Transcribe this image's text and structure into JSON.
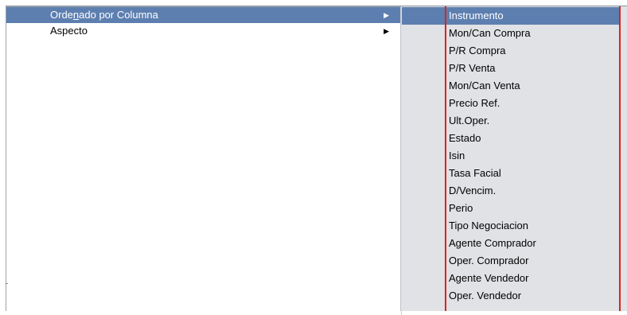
{
  "main_menu": {
    "items": [
      {
        "label": "Ordenado por Columna",
        "selected": true,
        "has_submenu": true
      },
      {
        "label": "Aspecto",
        "selected": false,
        "has_submenu": true
      }
    ],
    "submenu_arrow": "▶"
  },
  "submenu": {
    "items": [
      {
        "label": "Instrumento",
        "selected": true
      },
      {
        "label": "Mon/Can Compra",
        "selected": false
      },
      {
        "label": "P/R Compra",
        "selected": false
      },
      {
        "label": "P/R Venta",
        "selected": false
      },
      {
        "label": "Mon/Can Venta",
        "selected": false
      },
      {
        "label": "Precio Ref.",
        "selected": false
      },
      {
        "label": "Ult.Oper.",
        "selected": false
      },
      {
        "label": "Estado",
        "selected": false
      },
      {
        "label": "Isin",
        "selected": false
      },
      {
        "label": "Tasa Facial",
        "selected": false
      },
      {
        "label": "D/Vencim.",
        "selected": false
      },
      {
        "label": "Perio",
        "selected": false
      },
      {
        "label": "Tipo Negociacion",
        "selected": false
      },
      {
        "label": "Agente Comprador",
        "selected": false
      },
      {
        "label": "Oper. Comprador",
        "selected": false
      },
      {
        "label": "Agente Vendedor",
        "selected": false
      },
      {
        "label": "Oper. Vendedor",
        "selected": false
      }
    ]
  },
  "colors": {
    "selection": "#5d7fb0",
    "annotation_line": "#e02020",
    "submenu_bg": "#e0e2e5"
  }
}
